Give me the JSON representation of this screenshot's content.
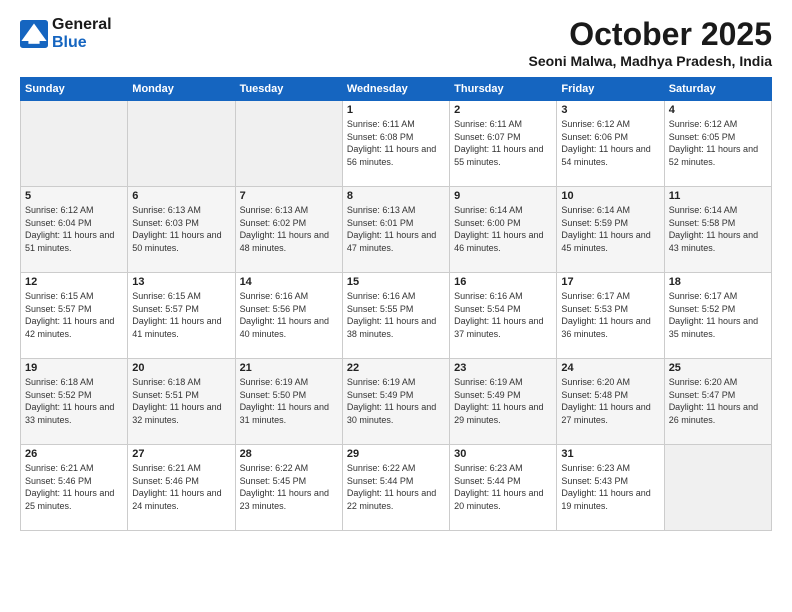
{
  "header": {
    "logo_line1": "General",
    "logo_line2": "Blue",
    "month": "October 2025",
    "location": "Seoni Malwa, Madhya Pradesh, India"
  },
  "weekdays": [
    "Sunday",
    "Monday",
    "Tuesday",
    "Wednesday",
    "Thursday",
    "Friday",
    "Saturday"
  ],
  "weeks": [
    [
      {
        "day": "",
        "content": ""
      },
      {
        "day": "",
        "content": ""
      },
      {
        "day": "",
        "content": ""
      },
      {
        "day": "1",
        "content": "Sunrise: 6:11 AM\nSunset: 6:08 PM\nDaylight: 11 hours\nand 56 minutes."
      },
      {
        "day": "2",
        "content": "Sunrise: 6:11 AM\nSunset: 6:07 PM\nDaylight: 11 hours\nand 55 minutes."
      },
      {
        "day": "3",
        "content": "Sunrise: 6:12 AM\nSunset: 6:06 PM\nDaylight: 11 hours\nand 54 minutes."
      },
      {
        "day": "4",
        "content": "Sunrise: 6:12 AM\nSunset: 6:05 PM\nDaylight: 11 hours\nand 52 minutes."
      }
    ],
    [
      {
        "day": "5",
        "content": "Sunrise: 6:12 AM\nSunset: 6:04 PM\nDaylight: 11 hours\nand 51 minutes."
      },
      {
        "day": "6",
        "content": "Sunrise: 6:13 AM\nSunset: 6:03 PM\nDaylight: 11 hours\nand 50 minutes."
      },
      {
        "day": "7",
        "content": "Sunrise: 6:13 AM\nSunset: 6:02 PM\nDaylight: 11 hours\nand 48 minutes."
      },
      {
        "day": "8",
        "content": "Sunrise: 6:13 AM\nSunset: 6:01 PM\nDaylight: 11 hours\nand 47 minutes."
      },
      {
        "day": "9",
        "content": "Sunrise: 6:14 AM\nSunset: 6:00 PM\nDaylight: 11 hours\nand 46 minutes."
      },
      {
        "day": "10",
        "content": "Sunrise: 6:14 AM\nSunset: 5:59 PM\nDaylight: 11 hours\nand 45 minutes."
      },
      {
        "day": "11",
        "content": "Sunrise: 6:14 AM\nSunset: 5:58 PM\nDaylight: 11 hours\nand 43 minutes."
      }
    ],
    [
      {
        "day": "12",
        "content": "Sunrise: 6:15 AM\nSunset: 5:57 PM\nDaylight: 11 hours\nand 42 minutes."
      },
      {
        "day": "13",
        "content": "Sunrise: 6:15 AM\nSunset: 5:57 PM\nDaylight: 11 hours\nand 41 minutes."
      },
      {
        "day": "14",
        "content": "Sunrise: 6:16 AM\nSunset: 5:56 PM\nDaylight: 11 hours\nand 40 minutes."
      },
      {
        "day": "15",
        "content": "Sunrise: 6:16 AM\nSunset: 5:55 PM\nDaylight: 11 hours\nand 38 minutes."
      },
      {
        "day": "16",
        "content": "Sunrise: 6:16 AM\nSunset: 5:54 PM\nDaylight: 11 hours\nand 37 minutes."
      },
      {
        "day": "17",
        "content": "Sunrise: 6:17 AM\nSunset: 5:53 PM\nDaylight: 11 hours\nand 36 minutes."
      },
      {
        "day": "18",
        "content": "Sunrise: 6:17 AM\nSunset: 5:52 PM\nDaylight: 11 hours\nand 35 minutes."
      }
    ],
    [
      {
        "day": "19",
        "content": "Sunrise: 6:18 AM\nSunset: 5:52 PM\nDaylight: 11 hours\nand 33 minutes."
      },
      {
        "day": "20",
        "content": "Sunrise: 6:18 AM\nSunset: 5:51 PM\nDaylight: 11 hours\nand 32 minutes."
      },
      {
        "day": "21",
        "content": "Sunrise: 6:19 AM\nSunset: 5:50 PM\nDaylight: 11 hours\nand 31 minutes."
      },
      {
        "day": "22",
        "content": "Sunrise: 6:19 AM\nSunset: 5:49 PM\nDaylight: 11 hours\nand 30 minutes."
      },
      {
        "day": "23",
        "content": "Sunrise: 6:19 AM\nSunset: 5:49 PM\nDaylight: 11 hours\nand 29 minutes."
      },
      {
        "day": "24",
        "content": "Sunrise: 6:20 AM\nSunset: 5:48 PM\nDaylight: 11 hours\nand 27 minutes."
      },
      {
        "day": "25",
        "content": "Sunrise: 6:20 AM\nSunset: 5:47 PM\nDaylight: 11 hours\nand 26 minutes."
      }
    ],
    [
      {
        "day": "26",
        "content": "Sunrise: 6:21 AM\nSunset: 5:46 PM\nDaylight: 11 hours\nand 25 minutes."
      },
      {
        "day": "27",
        "content": "Sunrise: 6:21 AM\nSunset: 5:46 PM\nDaylight: 11 hours\nand 24 minutes."
      },
      {
        "day": "28",
        "content": "Sunrise: 6:22 AM\nSunset: 5:45 PM\nDaylight: 11 hours\nand 23 minutes."
      },
      {
        "day": "29",
        "content": "Sunrise: 6:22 AM\nSunset: 5:44 PM\nDaylight: 11 hours\nand 22 minutes."
      },
      {
        "day": "30",
        "content": "Sunrise: 6:23 AM\nSunset: 5:44 PM\nDaylight: 11 hours\nand 20 minutes."
      },
      {
        "day": "31",
        "content": "Sunrise: 6:23 AM\nSunset: 5:43 PM\nDaylight: 11 hours\nand 19 minutes."
      },
      {
        "day": "",
        "content": ""
      }
    ]
  ]
}
